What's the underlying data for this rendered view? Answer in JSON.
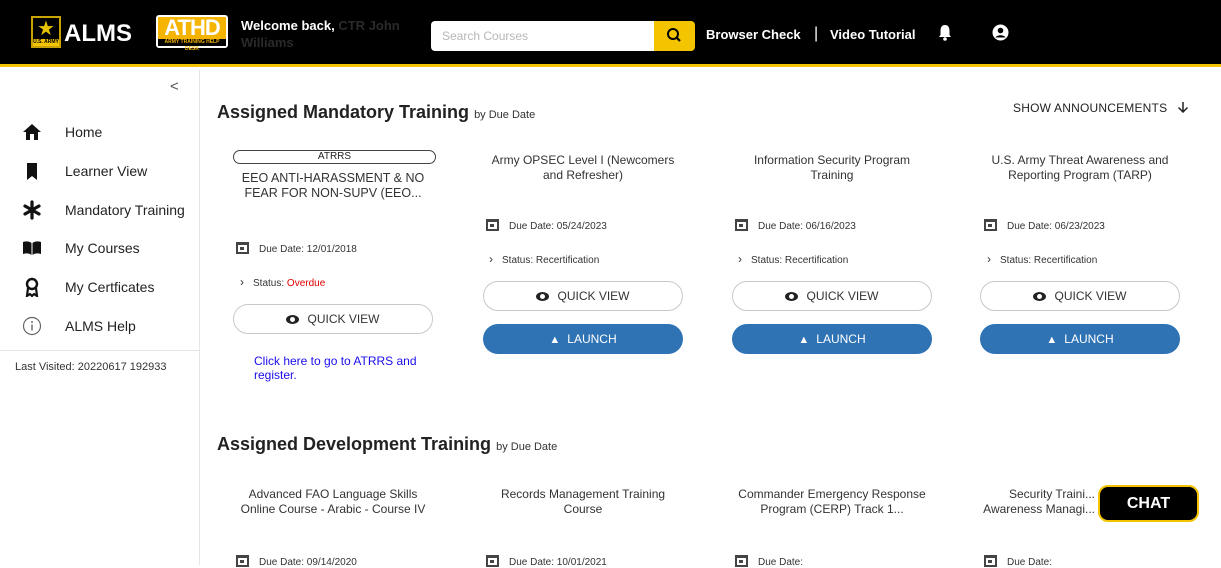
{
  "header": {
    "brand": "ALMS",
    "army_sub": "U.S. ARMY",
    "athd_logo": "ATHD",
    "athd_sub": "ARMY TRAINING HELP DESK",
    "welcome_prefix": "Welcome back,",
    "welcome_name": "CTR John Williams",
    "search_placeholder": "Search Courses",
    "browser_check": "Browser Check",
    "separator": "|",
    "video_tutorial": "Video Tutorial",
    "accent_color": "#f5c400"
  },
  "sidebar": {
    "collapse_glyph": "<",
    "items": [
      {
        "label": "Home",
        "icon": "home-icon"
      },
      {
        "label": "Learner View",
        "icon": "bookmark-icon"
      },
      {
        "label": "Mandatory Training",
        "icon": "asterisk-icon"
      },
      {
        "label": "My Courses",
        "icon": "open-book-icon"
      },
      {
        "label": "My Certficates",
        "icon": "ribbon-icon"
      },
      {
        "label": "ALMS Help",
        "icon": "info-icon"
      }
    ],
    "last_visited": "Last Visited: 20220617 192933"
  },
  "mandatory": {
    "title": "Assigned Mandatory Training",
    "subtitle": "by Due Date",
    "show_announcements": "SHOW ANNOUNCEMENTS",
    "cards": [
      {
        "tag": "ATRRS",
        "title": "EEO ANTI-HARASSMENT & NO FEAR FOR NON-SUPV (EEO...",
        "due": "Due Date:  12/01/2018",
        "status_prefix": "Status:",
        "status_value": "Overdue",
        "quick_view": "QUICK VIEW",
        "link": "Click here to go to ATRRS and register."
      },
      {
        "title": "Army OPSEC Level I (Newcomers and Refresher)",
        "due": "Due Date:  05/24/2023",
        "status": "Status: Recertification",
        "quick_view": "QUICK VIEW",
        "launch": "LAUNCH"
      },
      {
        "title": "Information Security Program Training",
        "due": "Due Date:  06/16/2023",
        "status": "Status: Recertification",
        "quick_view": "QUICK VIEW",
        "launch": "LAUNCH"
      },
      {
        "title": "U.S. Army Threat Awareness and Reporting Program (TARP)",
        "due": "Due Date:  06/23/2023",
        "status": "Status: Recertification",
        "quick_view": "QUICK VIEW",
        "launch": "LAUNCH"
      }
    ]
  },
  "development": {
    "title": "Assigned Development Training",
    "subtitle": "by Due Date",
    "cards": [
      {
        "title": "Advanced FAO Language Skills Online Course - Arabic - Course IV",
        "due": "Due Date:  09/14/2020"
      },
      {
        "title": "Records Management Training Course",
        "due": "Due Date:  10/01/2021"
      },
      {
        "title": "Commander Emergency Response Program (CERP) Track 1...",
        "due": "Due Date:"
      },
      {
        "title": "Security Traini... Awareness Managi...",
        "due": "Due Date:"
      }
    ]
  },
  "chat": {
    "label": "CHAT"
  }
}
